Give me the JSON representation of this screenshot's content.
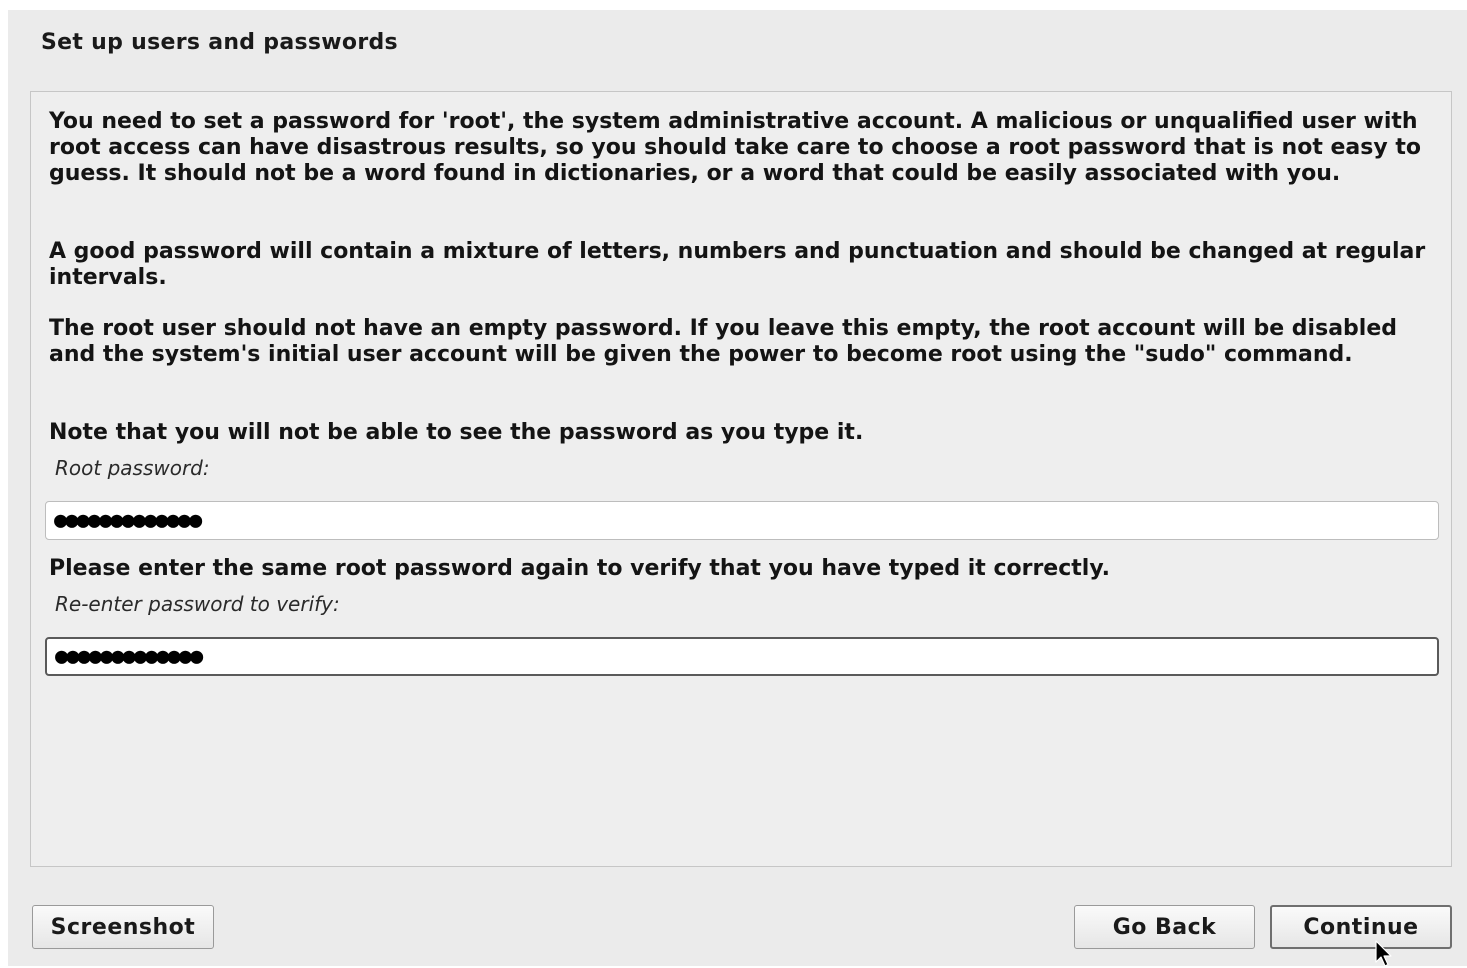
{
  "header": {
    "title": "Set up users and passwords"
  },
  "main": {
    "paragraphs": [
      "You need to set a password for 'root', the system administrative account. A malicious or unqualified user with root access can have disastrous results, so you should take care to choose a root password that is not easy to guess. It should not be a word found in dictionaries, or a word that could be easily associated with you.",
      "A good password will contain a mixture of letters, numbers and punctuation and should be changed at regular intervals.",
      "The root user should not have an empty password. If you leave this empty, the root account will be disabled and the system's initial user account will be given the power to become root using the \"sudo\" command.",
      "Note that you will not be able to see the password as you type it."
    ],
    "root_password": {
      "label": "Root password:",
      "value": "●●●●●●●●●●●●●"
    },
    "verify_prompt": "Please enter the same root password again to verify that you have typed it correctly.",
    "verify_password": {
      "label": "Re-enter password to verify:",
      "value": "●●●●●●●●●●●●●"
    }
  },
  "footer": {
    "screenshot_label": "Screenshot",
    "go_back_label": "Go Back",
    "continue_label": "Continue"
  },
  "icons": {
    "cursor": "mouse-pointer-icon"
  }
}
